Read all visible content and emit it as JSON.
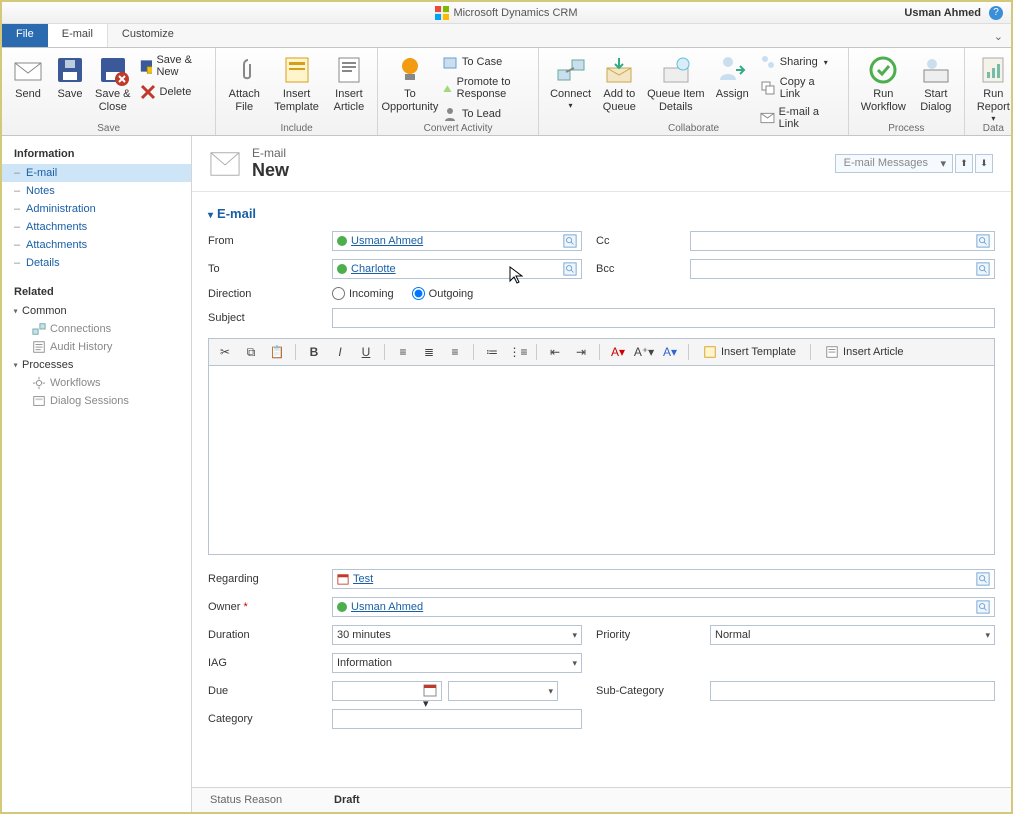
{
  "app": {
    "title": "Microsoft Dynamics CRM",
    "user": "Usman Ahmed"
  },
  "tabs": {
    "file": "File",
    "active": "E-mail",
    "other": "Customize"
  },
  "ribbon": {
    "save_group": "Save",
    "send": "Send",
    "save": "Save",
    "save_close": "Save &\nClose",
    "save_new": "Save & New",
    "delete": "Delete",
    "include_group": "Include",
    "attach_file": "Attach\nFile",
    "insert_template": "Insert\nTemplate",
    "insert_article": "Insert\nArticle",
    "convert_group": "Convert Activity",
    "to_opportunity": "To\nOpportunity",
    "to_case": "To Case",
    "promote": "Promote to Response",
    "to_lead": "To Lead",
    "collaborate_group": "Collaborate",
    "connect": "Connect",
    "add_queue": "Add to\nQueue",
    "queue_details": "Queue Item\nDetails",
    "assign": "Assign",
    "sharing": "Sharing",
    "copy_link": "Copy a Link",
    "email_link": "E-mail a Link",
    "process_group": "Process",
    "run_workflow": "Run\nWorkflow",
    "start_dialog": "Start\nDialog",
    "data_group": "Data",
    "run_report": "Run\nReport"
  },
  "sidebar": {
    "information": "Information",
    "items": [
      "E-mail",
      "Notes",
      "Administration",
      "Attachments",
      "Attachments",
      "Details"
    ],
    "related": "Related",
    "common": "Common",
    "connections": "Connections",
    "audit": "Audit History",
    "processes": "Processes",
    "workflows": "Workflows",
    "dialogs": "Dialog Sessions"
  },
  "header": {
    "type": "E-mail",
    "name": "New",
    "combo": "E-mail Messages"
  },
  "form": {
    "section": "E-mail",
    "from_lbl": "From",
    "from_val": "Usman Ahmed",
    "to_lbl": "To",
    "to_val": "Charlotte",
    "cc_lbl": "Cc",
    "bcc_lbl": "Bcc",
    "direction_lbl": "Direction",
    "incoming": "Incoming",
    "outgoing": "Outgoing",
    "subject_lbl": "Subject",
    "insert_template_btn": "Insert Template",
    "insert_article_btn": "Insert Article",
    "regarding_lbl": "Regarding",
    "regarding_val": "Test",
    "owner_lbl": "Owner",
    "owner_val": "Usman Ahmed",
    "duration_lbl": "Duration",
    "duration_val": "30 minutes",
    "priority_lbl": "Priority",
    "priority_val": "Normal",
    "iag_lbl": "IAG",
    "iag_val": "Information",
    "due_lbl": "Due",
    "sub_category_lbl": "Sub-Category",
    "category_lbl": "Category",
    "status_reason_lbl": "Status Reason",
    "status_reason_val": "Draft"
  }
}
